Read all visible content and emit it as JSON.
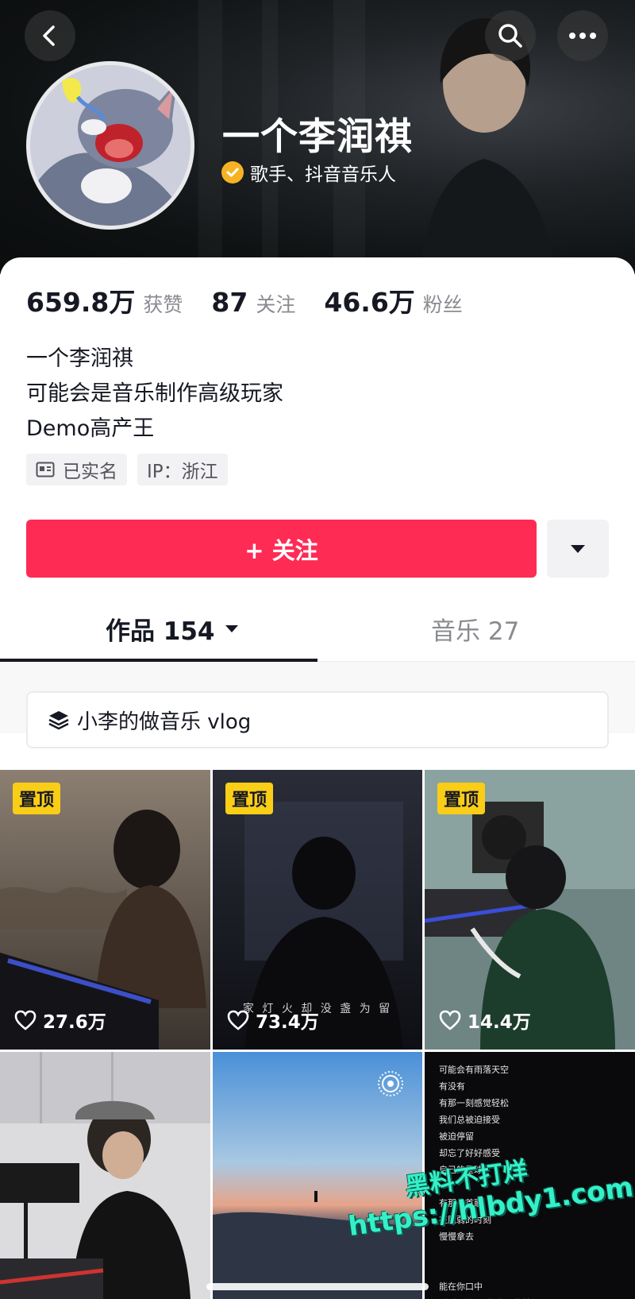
{
  "profile": {
    "name": "一个李润祺",
    "verified_title": "歌手、抖音音乐人"
  },
  "stats": [
    {
      "value": "659.8万",
      "label": "获赞"
    },
    {
      "value": "87",
      "label": "关注"
    },
    {
      "value": "46.6万",
      "label": "粉丝"
    }
  ],
  "bio": [
    "一个李润祺",
    "可能会是音乐制作高级玩家",
    "Demo高产王"
  ],
  "tags": {
    "realname": "已实名",
    "ip": "IP：浙江"
  },
  "follow_button": "+ 关注",
  "tabs": {
    "works": "作品 154",
    "music": "音乐 27"
  },
  "collection": "小李的做音乐 vlog",
  "videos": [
    {
      "pinned": "置顶",
      "likes": "27.6万"
    },
    {
      "pinned": "置顶",
      "likes": "73.4万",
      "caption": "家 灯 火   却 没 盏 为 留"
    },
    {
      "pinned": "置顶",
      "likes": "14.4万"
    },
    {},
    {},
    {
      "lyrics": "可能会有雨落天空\n有没有\n有那一刻感觉轻松\n我们总被迫接受\n被迫停留\n却忘了好好感受\n自己的星球\n\n有那一首歌\n在脆弱的时刻\n慢慢拿去\n\n\n能在你口中\n听到“我还没放弃一些梦”\n浪潮翻涌\n所幸能感到我"
    }
  ],
  "watermark": {
    "line1": "黑料不打烊",
    "line2": "https://hlbdy1.com"
  },
  "colors": {
    "accent": "#fe2c55",
    "pin": "#facd17",
    "verified": "#f5b324"
  }
}
